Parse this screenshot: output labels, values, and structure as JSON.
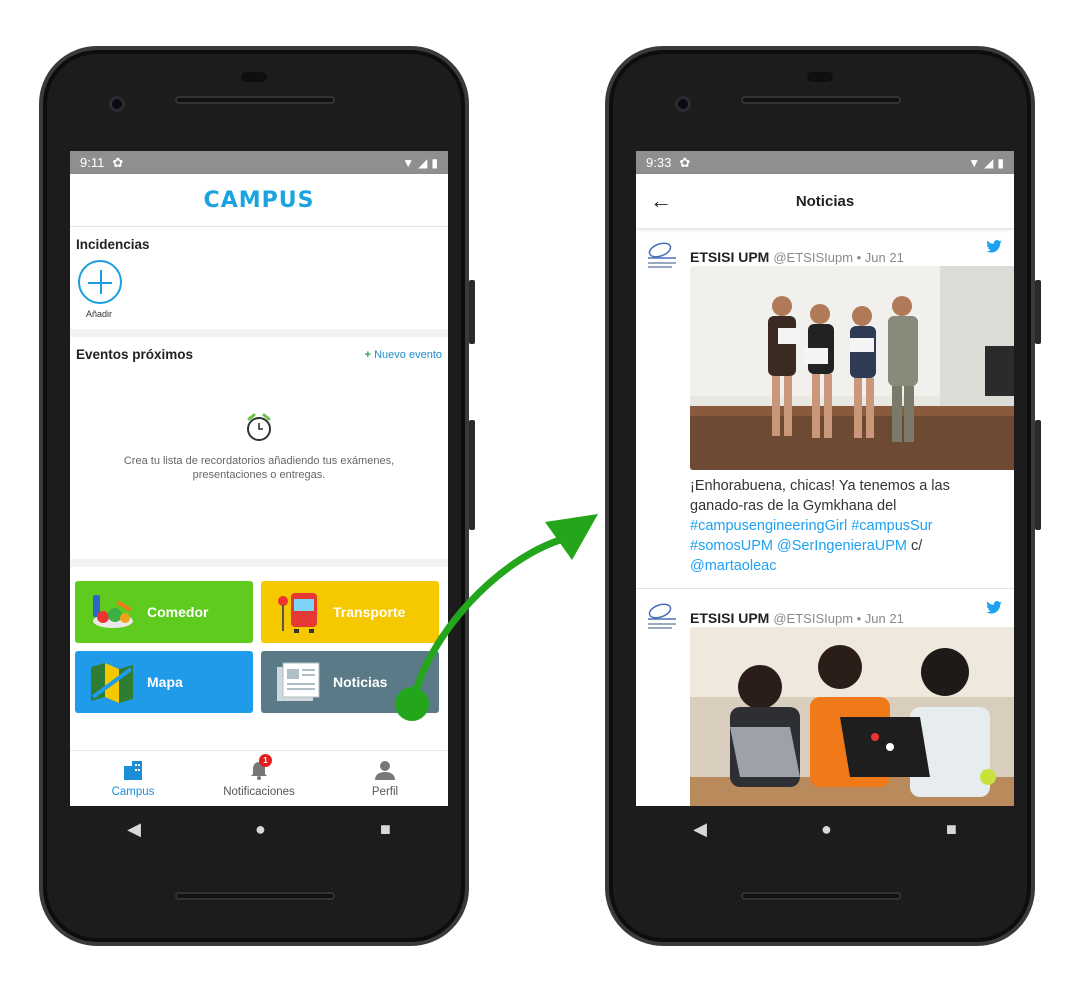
{
  "left_phone": {
    "status": {
      "time": "9:11"
    },
    "header": {
      "logo": "CAMPUS"
    },
    "incidencias": {
      "title": "Incidencias",
      "add_label": "Añadir"
    },
    "eventos": {
      "title": "Eventos próximos",
      "new_event_label": "Nuevo evento",
      "empty_text": "Crea tu lista de recordatorios añadiendo tus exámenes, presentaciones o entregas."
    },
    "tiles": [
      {
        "label": "Comedor",
        "color": "#5fcb1e"
      },
      {
        "label": "Transporte",
        "color": "#f6c800"
      },
      {
        "label": "Mapa",
        "color": "#1f9bea"
      },
      {
        "label": "Noticias",
        "color": "#5a7a88"
      }
    ],
    "bottom_nav": [
      {
        "label": "Campus",
        "icon": "building-icon",
        "active": true
      },
      {
        "label": "Notificaciones",
        "icon": "bell-icon",
        "badge": "1"
      },
      {
        "label": "Perfil",
        "icon": "person-icon"
      }
    ]
  },
  "right_phone": {
    "status": {
      "time": "9:33"
    },
    "header": {
      "title": "Noticias"
    },
    "tweets": [
      {
        "name": "ETSISI UPM",
        "handle": "@ETSISIupm • Jun 21",
        "text_plain_1": "¡Enhorabuena, chicas! Ya tenemos a las ganado-ras de la Gymkhana del ",
        "link_1": "#campusengineeringGirl",
        "link_2": "#campusSur #somosUPM @SerIngenieraUPM",
        "text_plain_2": "c/ ",
        "link_3": "@martaoleac"
      },
      {
        "name": "ETSISI UPM",
        "handle": "@ETSISIupm • Jun 21"
      }
    ]
  },
  "colors": {
    "accent_blue": "#1a9ee0",
    "arrow_green": "#23a61b",
    "twitter_blue": "#1da1f2"
  }
}
